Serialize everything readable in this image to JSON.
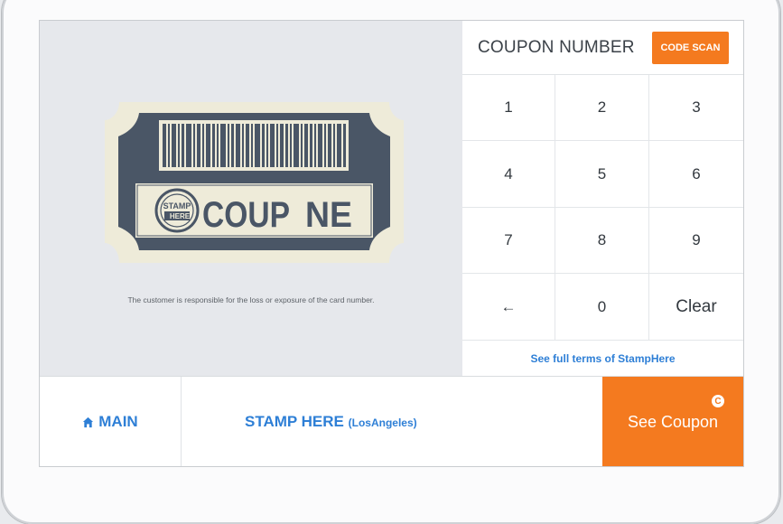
{
  "coupon_panel": {
    "title": "COUPON NUMBER",
    "scan_button": "CODE SCAN"
  },
  "keypad": {
    "keys": [
      "1",
      "2",
      "3",
      "4",
      "5",
      "6",
      "7",
      "8",
      "9",
      "←",
      "0",
      "Clear"
    ]
  },
  "terms_link": "See full terms of StampHere",
  "ticket": {
    "stamp_line1": "STAMP",
    "stamp_line2": "HERE",
    "word_left": "COUP",
    "word_right": "NE"
  },
  "disclaimer": "The customer is responsible for the loss or exposure of the card number.",
  "bottom_bar": {
    "main_label": "MAIN",
    "store_name": "STAMP HERE",
    "store_location": "(LosAngeles)",
    "see_coupon_label": "See Coupon",
    "badge_letter": "C"
  },
  "colors": {
    "accent_orange": "#f47a1f",
    "link_blue": "#2e7fd6",
    "ticket_dark": "#4a5666",
    "ticket_cream": "#eeebd9"
  }
}
